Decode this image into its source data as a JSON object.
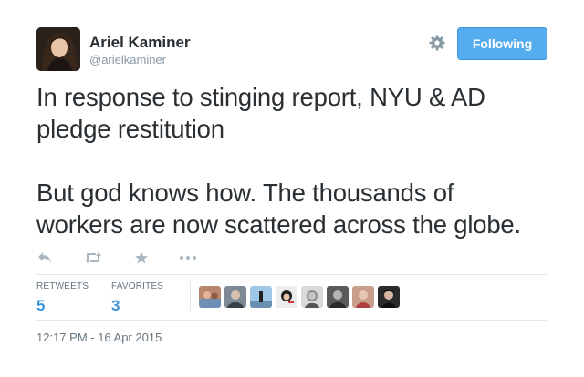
{
  "author": {
    "name": "Ariel Kaminer",
    "handle": "@arielkaminer",
    "avatar_icon": "profile-photo"
  },
  "follow_button": {
    "label": "Following",
    "color": "#55acee"
  },
  "settings_icon": "gear-icon",
  "tweet": {
    "lines_para1": [
      "In response to stinging report, NYU & AD",
      "pledge restitution"
    ],
    "lines_para2": [
      "But god knows how. The thousands of",
      "workers are now scattered across the globe."
    ]
  },
  "actions": [
    {
      "name": "reply",
      "icon": "reply-icon"
    },
    {
      "name": "retweet",
      "icon": "retweet-icon"
    },
    {
      "name": "favorite",
      "icon": "star-icon"
    },
    {
      "name": "more",
      "icon": "more-icon"
    }
  ],
  "stats": {
    "retweets": {
      "label": "RETWEETS",
      "value": "5"
    },
    "favorites": {
      "label": "FAVORITES",
      "value": "3"
    }
  },
  "favoriters_count_shown": 8,
  "timestamp": "12:17 PM - 16 Apr 2015",
  "colors": {
    "text": "#292f33",
    "muted": "#8899a6",
    "link": "#3b94d9",
    "icon": "#aab8c2",
    "divider": "#e1e8ed"
  }
}
